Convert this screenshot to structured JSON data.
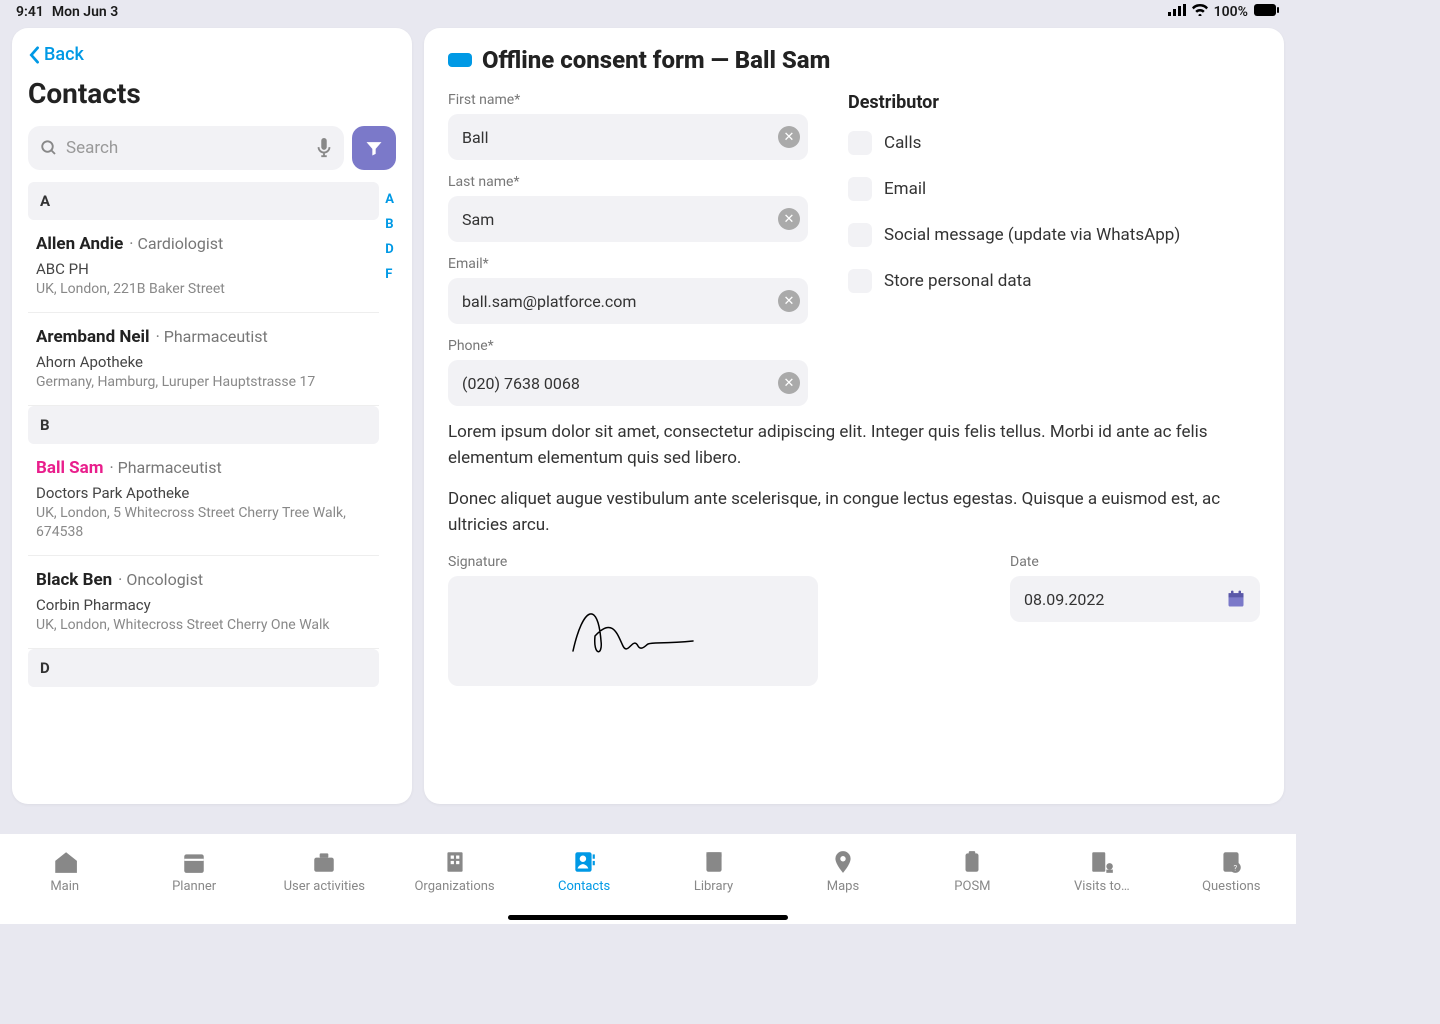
{
  "status": {
    "time": "9:41",
    "date": "Mon Jun 3",
    "battery": "100%"
  },
  "sidebar": {
    "back": "Back",
    "title": "Contacts",
    "search_placeholder": "Search",
    "index": [
      "A",
      "B",
      "D",
      "F"
    ],
    "sections": [
      {
        "letter": "A",
        "contacts": [
          {
            "name": "Allen Andie",
            "role": "Cardiologist",
            "org": "ABC PH",
            "addr": "UK, London, 221B Baker Street"
          },
          {
            "name": "Aremband Neil",
            "role": "Pharmaceutist",
            "org": "Ahorn Apotheke",
            "addr": "Germany, Hamburg, Luruper Hauptstrasse 17"
          }
        ]
      },
      {
        "letter": "B",
        "contacts": [
          {
            "name": "Ball Sam",
            "role": "Pharmaceutist",
            "org": "Doctors Park Apotheke",
            "addr": "UK, London, 5 Whitecross Street Cherry Tree Walk, 674538",
            "active": true
          },
          {
            "name": "Black Ben",
            "role": "Oncologist",
            "org": "Corbin Pharmacy",
            "addr": "UK, London, Whitecross Street Cherry One Walk"
          }
        ]
      },
      {
        "letter": "D",
        "contacts": []
      }
    ]
  },
  "form": {
    "title": "Offline consent form — Ball Sam",
    "fields": {
      "first_name": {
        "label": "First name*",
        "value": "Ball"
      },
      "last_name": {
        "label": "Last name*",
        "value": "Sam"
      },
      "email": {
        "label": "Email*",
        "value": "ball.sam@platforce.com"
      },
      "phone": {
        "label": "Phone*",
        "value": "(020) 7638 0068"
      }
    },
    "distributor": {
      "title": "Destributor",
      "options": [
        "Calls",
        "Email",
        "Social message (update via WhatsApp)",
        "Store personal data"
      ]
    },
    "body": [
      "Lorem ipsum dolor sit amet, consectetur adipiscing elit. Integer quis felis tellus. Morbi id ante ac felis elementum elementum quis sed libero.",
      "Donec aliquet augue vestibulum ante scelerisque, in congue lectus egestas. Quisque a euismod est, ac ultricies arcu."
    ],
    "signature_label": "Signature",
    "date_label": "Date",
    "date_value": "08.09.2022"
  },
  "tabs": [
    {
      "label": "Main",
      "icon": "home"
    },
    {
      "label": "Planner",
      "icon": "calendar"
    },
    {
      "label": "User activities",
      "icon": "briefcase"
    },
    {
      "label": "Organizations",
      "icon": "building"
    },
    {
      "label": "Contacts",
      "icon": "contact",
      "active": true
    },
    {
      "label": "Library",
      "icon": "book"
    },
    {
      "label": "Maps",
      "icon": "pin"
    },
    {
      "label": "POSM",
      "icon": "clipboard"
    },
    {
      "label": "Visits to…",
      "icon": "visits"
    },
    {
      "label": "Questions",
      "icon": "question"
    }
  ]
}
